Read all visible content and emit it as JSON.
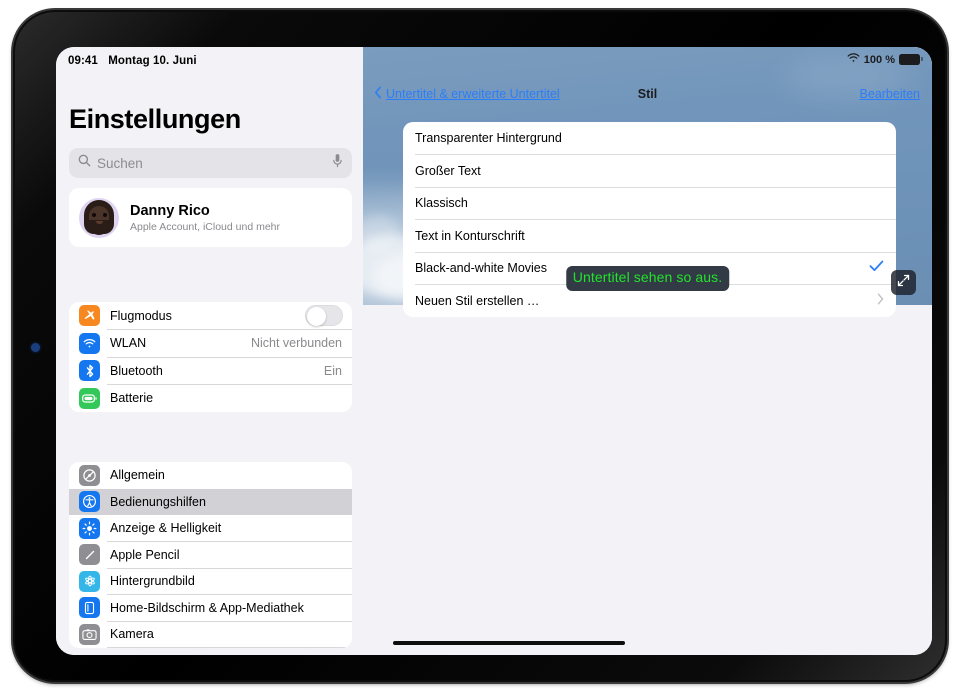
{
  "device": {
    "bezel_marker": "callout-dot"
  },
  "sidebar": {
    "statusbar": {
      "time": "09:41",
      "date": "Montag 10. Juni"
    },
    "title": "Einstellungen",
    "search": {
      "placeholder": "Suchen",
      "value": "",
      "search_icon": "search-icon",
      "dictation_icon": "microphone-icon"
    },
    "account": {
      "name": "Danny Rico",
      "subtitle": "Apple Account, iCloud und mehr",
      "avatar": "memoji-avatar"
    },
    "groups": [
      {
        "name": "connectivity",
        "items": [
          {
            "label": "Flugmodus",
            "icon": "airplane-icon",
            "icon_color": "#f7881f",
            "control": "toggle",
            "toggle_on": false
          },
          {
            "label": "WLAN",
            "icon": "wifi-icon",
            "icon_color": "#1577ef",
            "value": "Nicht verbunden"
          },
          {
            "label": "Bluetooth",
            "icon": "bluetooth-icon",
            "icon_color": "#1577ef",
            "value": "Ein"
          },
          {
            "label": "Batterie",
            "icon": "battery-icon",
            "icon_color": "#34c759",
            "value": ""
          }
        ]
      },
      {
        "name": "apps",
        "items": [
          {
            "label": "Allgemein",
            "icon": "gear-icon",
            "icon_color": "#8e8e93",
            "selected": false
          },
          {
            "label": "Bedienungshilfen",
            "icon": "accessibility-icon",
            "icon_color": "#1577ef",
            "selected": true
          },
          {
            "label": "Anzeige & Helligkeit",
            "icon": "brightness-icon",
            "icon_color": "#1577ef",
            "selected": false
          },
          {
            "label": "Apple Pencil",
            "icon": "pencil-icon",
            "icon_color": "#8e8e93",
            "selected": false
          },
          {
            "label": "Hintergrundbild",
            "icon": "wallpaper-icon",
            "icon_color": "#35b6e8",
            "selected": false
          },
          {
            "label": "Home-Bildschirm & App-Mediathek",
            "icon": "home-screen-icon",
            "icon_color": "#1577ef",
            "selected": false
          },
          {
            "label": "Kamera",
            "icon": "camera-icon",
            "icon_color": "#8e8e93",
            "selected": false
          }
        ]
      }
    ]
  },
  "detail": {
    "statusbar": {
      "wifi_icon": "wifi-icon",
      "battery_percent": "100 %",
      "battery_icon": "battery-full-icon"
    },
    "navbar": {
      "back_label": "Untertitel & erweiterte Untertitel",
      "back_icon": "chevron-left-icon",
      "title": "Stil",
      "edit_label": "Bearbeiten"
    },
    "preview": {
      "caption_text": "Untertitel sehen so aus.",
      "caption_color": "#22e32a",
      "caption_background": "#313a45",
      "expand_icon": "expand-arrows-icon"
    },
    "styles": {
      "rows": [
        {
          "label": "Transparenter Hintergrund",
          "accessory": "none"
        },
        {
          "label": "Großer Text",
          "accessory": "none"
        },
        {
          "label": "Klassisch",
          "accessory": "none"
        },
        {
          "label": "Text in Konturschrift",
          "accessory": "none"
        },
        {
          "label": "Black-and-white Movies",
          "accessory": "checkmark"
        },
        {
          "label": "Neuen Stil erstellen …",
          "accessory": "chevron"
        }
      ]
    },
    "home_indicator": "home-indicator"
  },
  "colors": {
    "accent_blue": "#2c7ef8",
    "selected_row": "#d1d1d6",
    "grouped_background": "#f2f2f7"
  }
}
